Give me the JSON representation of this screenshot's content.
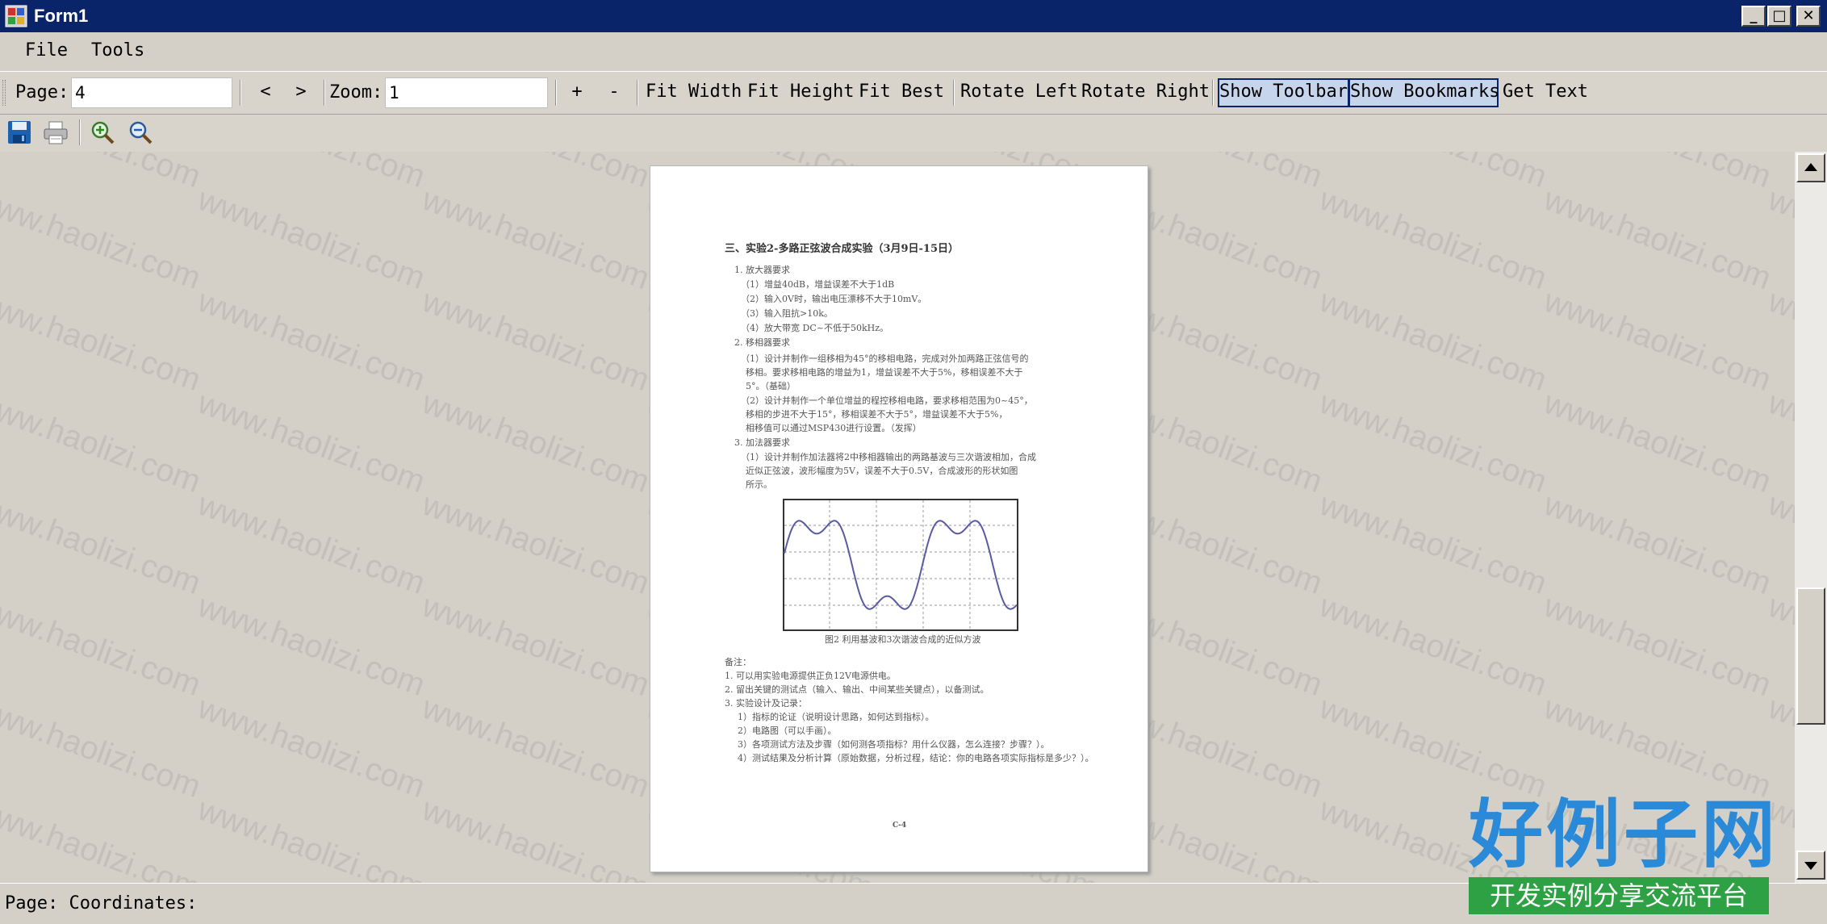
{
  "window": {
    "title": "Form1"
  },
  "menu": {
    "file": "File",
    "tools": "Tools"
  },
  "toolbar": {
    "page_label": "Page:",
    "page_value": "4",
    "prev": "<",
    "next": ">",
    "zoom_label": "Zoom:",
    "zoom_value": "1",
    "zoom_in": "+",
    "zoom_out": "-",
    "fit_width": "Fit Width",
    "fit_height": "Fit Height",
    "fit_best": "Fit Best",
    "rotate_left": "Rotate Left",
    "rotate_right": "Rotate Right",
    "show_toolbar": "Show Toolbar",
    "show_bookmarks": "Show Bookmarks",
    "get_text": "Get Text"
  },
  "icons": [
    "save-icon",
    "print-icon",
    "zoom-in-icon",
    "zoom-out-icon"
  ],
  "document": {
    "heading": "三、实验2-多路正弦波合成实验（3月9日-15日）",
    "lines": [
      "1. 放大器要求",
      "（1）增益40dB，增益误差不大于1dB",
      "（2）输入0V时，输出电压漂移不大于10mV。",
      "（3）输入阻抗>10k。",
      "（4）放大带宽 DC~不低于50kHz。",
      "2. 移相器要求",
      "（1）设计并制作一组移相为45°的移相电路，完成对外加两路正弦信号的",
      "移相。要求移相电路的增益为1，增益误差不大于5%，移相误差不大于",
      "5°。（基础）",
      "（2）设计并制作一个单位增益的程控移相电路，要求移相范围为0~45°，",
      "移相的步进不大于15°，移相误差不大于5°，增益误差不大于5%，",
      "相移值可以通过MSP430进行设置。（发挥）",
      "3. 加法器要求",
      "（1）设计并制作加法器将2中移相器输出的两路基波与三次谐波相加，合成",
      "近似正弦波，波形幅度为5V，误差不大于0.5V，合成波形的形状如图",
      "所示。"
    ],
    "figure_caption": "图2  利用基波和3次谐波合成的近似方波",
    "notes": [
      "备注：",
      "1. 可以用实验电源提供正负12V电源供电。",
      "2. 留出关键的测试点（输入、输出、中间某些关键点），以备测试。",
      "3. 实验设计及记录：",
      "1）指标的论证（说明设计思路，如何达到指标）。",
      "2）电路图（可以手画）。",
      "3）各项测试方法及步骤（如何测各项指标？用什么仪器，怎么连接？步骤？）。",
      "4）测试结果及分析计算（原始数据，分析过程，结论：你的电路各项实际指标是多少？）。"
    ],
    "page_footer": "C-4"
  },
  "status": {
    "text": "Page: Coordinates:"
  },
  "watermark": {
    "text": "www.haolizi.com",
    "brand": "好例子网",
    "brand_sub": "开发实例分享交流平台"
  }
}
